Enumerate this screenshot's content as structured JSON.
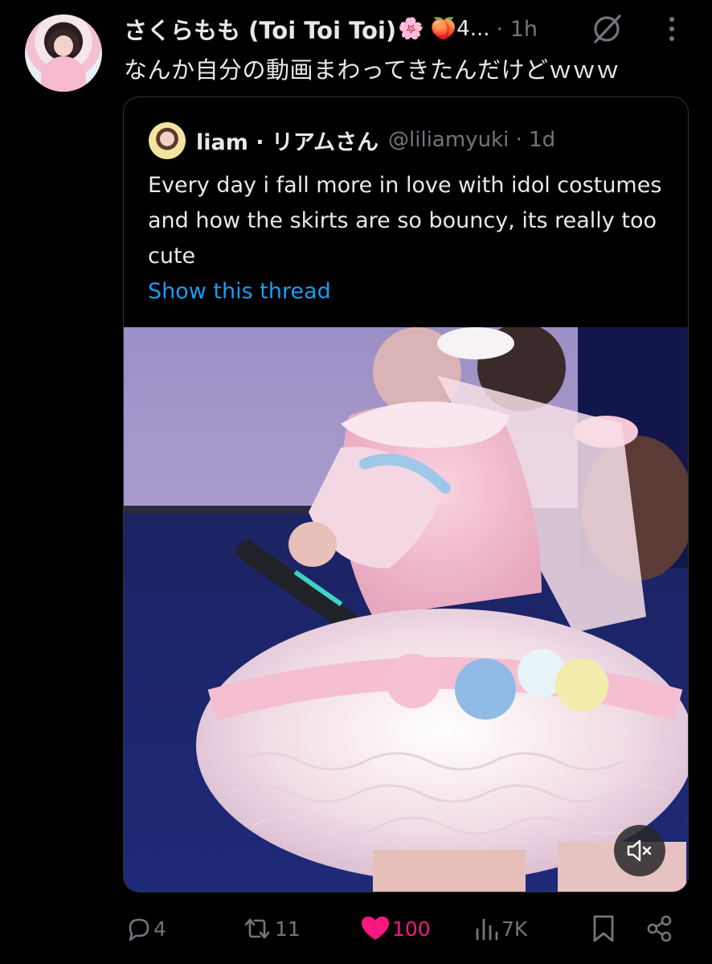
{
  "author": {
    "name": "さくらもも (Toi Toi Toi)",
    "name_emoji": "🌸 🍑4...",
    "time": "· 1h"
  },
  "tweet": {
    "text": "なんか自分の動画まわってきたんだけどｗｗｗ"
  },
  "quote": {
    "name": "liam · リアムさん",
    "handle": "@liliamyuki · 1d",
    "text": "Every day i fall more in love with idol costumes and how the skirts are so bouncy, its really too cute",
    "link": "Show this thread"
  },
  "actions": {
    "replies": "4",
    "retweets": "11",
    "likes": "100",
    "views": "7K"
  },
  "colors": {
    "background": "#000000",
    "text": "#e7e9ea",
    "muted": "#71767b",
    "link": "#1d9bf0",
    "like": "#f91880"
  },
  "icons": {
    "reply": "reply-icon",
    "retweet": "retweet-icon",
    "like": "heart-filled-icon",
    "views": "views-icon",
    "bookmark": "bookmark-icon",
    "share": "share-icon",
    "grok": "grok-icon",
    "more": "more-vertical-icon",
    "mute": "volume-muted-icon"
  }
}
